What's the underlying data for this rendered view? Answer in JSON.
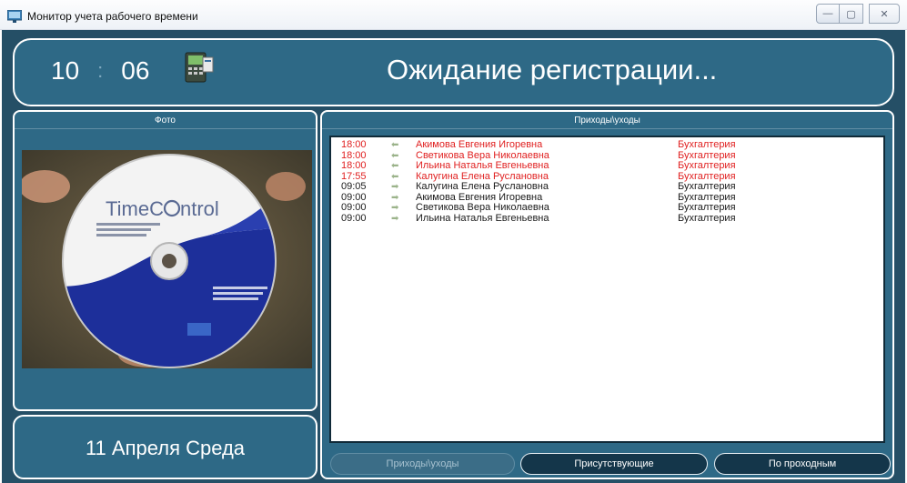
{
  "window": {
    "title": "Монитор учета рабочего времени",
    "controls": {
      "minimize": "—",
      "maximize": "▢",
      "close": "✕"
    }
  },
  "header": {
    "hours": "10",
    "separator": ":",
    "minutes": "06",
    "status": "Ожидание регистрации..."
  },
  "photo_panel": {
    "title": "Фото",
    "photo": {
      "brand": "TimeControl",
      "brand_part_a": "TimeC",
      "brand_part_b": "ntrol"
    }
  },
  "date_panel": {
    "date": "11 Апреля Среда"
  },
  "log_panel": {
    "title": "Приходы\\уходы",
    "rows": [
      {
        "time": "18:00",
        "name": "Акимова Евгения Игоревна",
        "dept": "Бухгалтерия",
        "direction": "out",
        "arrow": "⬅"
      },
      {
        "time": "18:00",
        "name": "Светикова Вера Николаевна",
        "dept": "Бухгалтерия",
        "direction": "out",
        "arrow": "⬅"
      },
      {
        "time": "18:00",
        "name": "Ильина Наталья Евгеньевна",
        "dept": "Бухгалтерия",
        "direction": "out",
        "arrow": "⬅"
      },
      {
        "time": "17:55",
        "name": "Калугина Елена Руслановна",
        "dept": "Бухгалтерия",
        "direction": "out",
        "arrow": "⬅"
      },
      {
        "time": "09:05",
        "name": "Калугина Елена Руслановна",
        "dept": "Бухгалтерия",
        "direction": "in",
        "arrow": "➡"
      },
      {
        "time": "09:00",
        "name": "Акимова Евгения Игоревна",
        "dept": "Бухгалтерия",
        "direction": "in",
        "arrow": "➡"
      },
      {
        "time": "09:00",
        "name": "Светикова Вера Николаевна",
        "dept": "Бухгалтерия",
        "direction": "in",
        "arrow": "➡"
      },
      {
        "time": "09:00",
        "name": "Ильина Наталья Евгеньевна",
        "dept": "Бухгалтерия",
        "direction": "in",
        "arrow": "➡"
      }
    ]
  },
  "tabs": [
    {
      "label": "Приходы\\уходы",
      "active": true
    },
    {
      "label": "Присутствующие",
      "active": false
    },
    {
      "label": "По проходным",
      "active": false
    }
  ],
  "colors": {
    "frame": "#254f66",
    "panel": "#2e6986",
    "out_text": "#e02020",
    "in_text": "#1a1a1a"
  },
  "icons": {
    "app": "monitor-app-icon",
    "reader": "card-reader-icon",
    "arrow_out": "arrow-left-icon",
    "arrow_in": "arrow-right-icon"
  }
}
